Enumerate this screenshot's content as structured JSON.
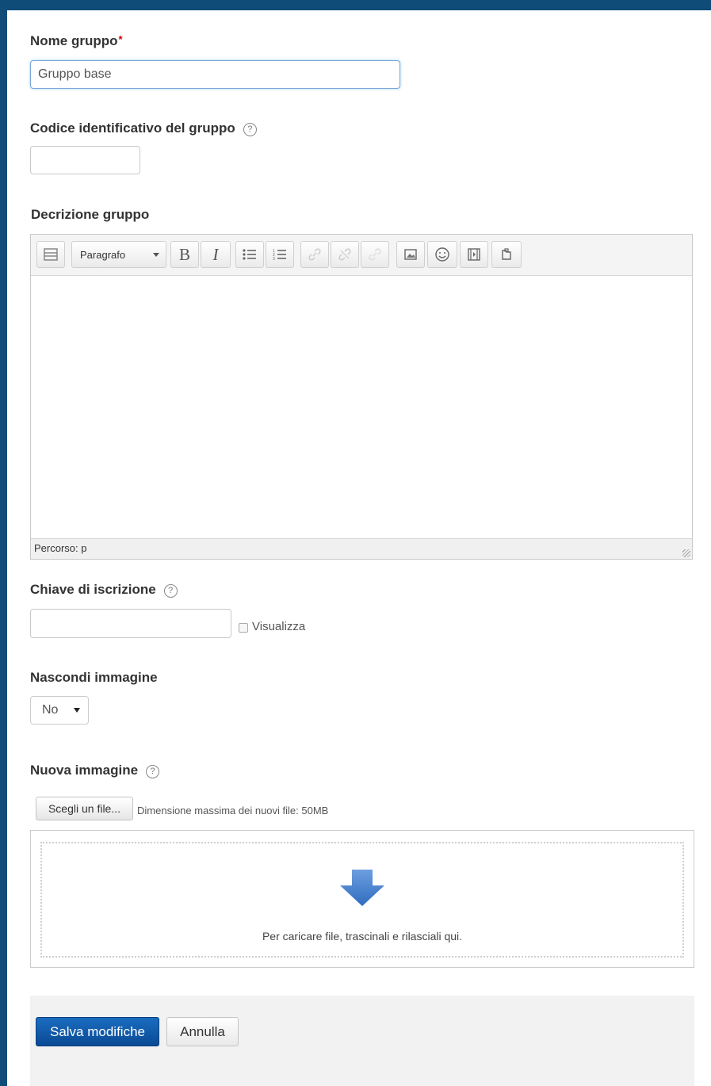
{
  "form": {
    "group_name": {
      "label": "Nome gruppo",
      "required_mark": "*",
      "value": "Gruppo base"
    },
    "id_number": {
      "label": "Codice identificativo del gruppo",
      "help": "?",
      "value": ""
    },
    "description": {
      "label": "Decrizione gruppo",
      "format_select": "Paragrafo",
      "bold_label": "B",
      "italic_label": "I",
      "path_text": "Percorso: p",
      "toolbar_icons": [
        "toolbar-toggle-icon",
        "bullet-list-icon",
        "numbered-list-icon",
        "link-icon",
        "unlink-icon",
        "anchor-icon",
        "image-icon",
        "emoticon-icon",
        "media-icon",
        "manage-files-icon"
      ]
    },
    "enrolment_key": {
      "label": "Chiave di iscrizione",
      "help": "?",
      "value": "",
      "show_label": "Visualizza"
    },
    "hide_picture": {
      "label": "Nascondi immagine",
      "selected": "No"
    },
    "new_picture": {
      "label": "Nuova immagine",
      "help": "?",
      "choose_button": "Scegli un file...",
      "max_size_text": "Dimensione massima dei nuovi file: 50MB",
      "drop_text": "Per caricare file, trascinali e rilasciali qui."
    },
    "actions": {
      "save": "Salva modifiche",
      "cancel": "Annulla"
    }
  },
  "colors": {
    "frame": "#0f4c78",
    "primary_button": "#0a4a94",
    "drop_arrow": "#4a86d0",
    "required": "#cc0000"
  }
}
